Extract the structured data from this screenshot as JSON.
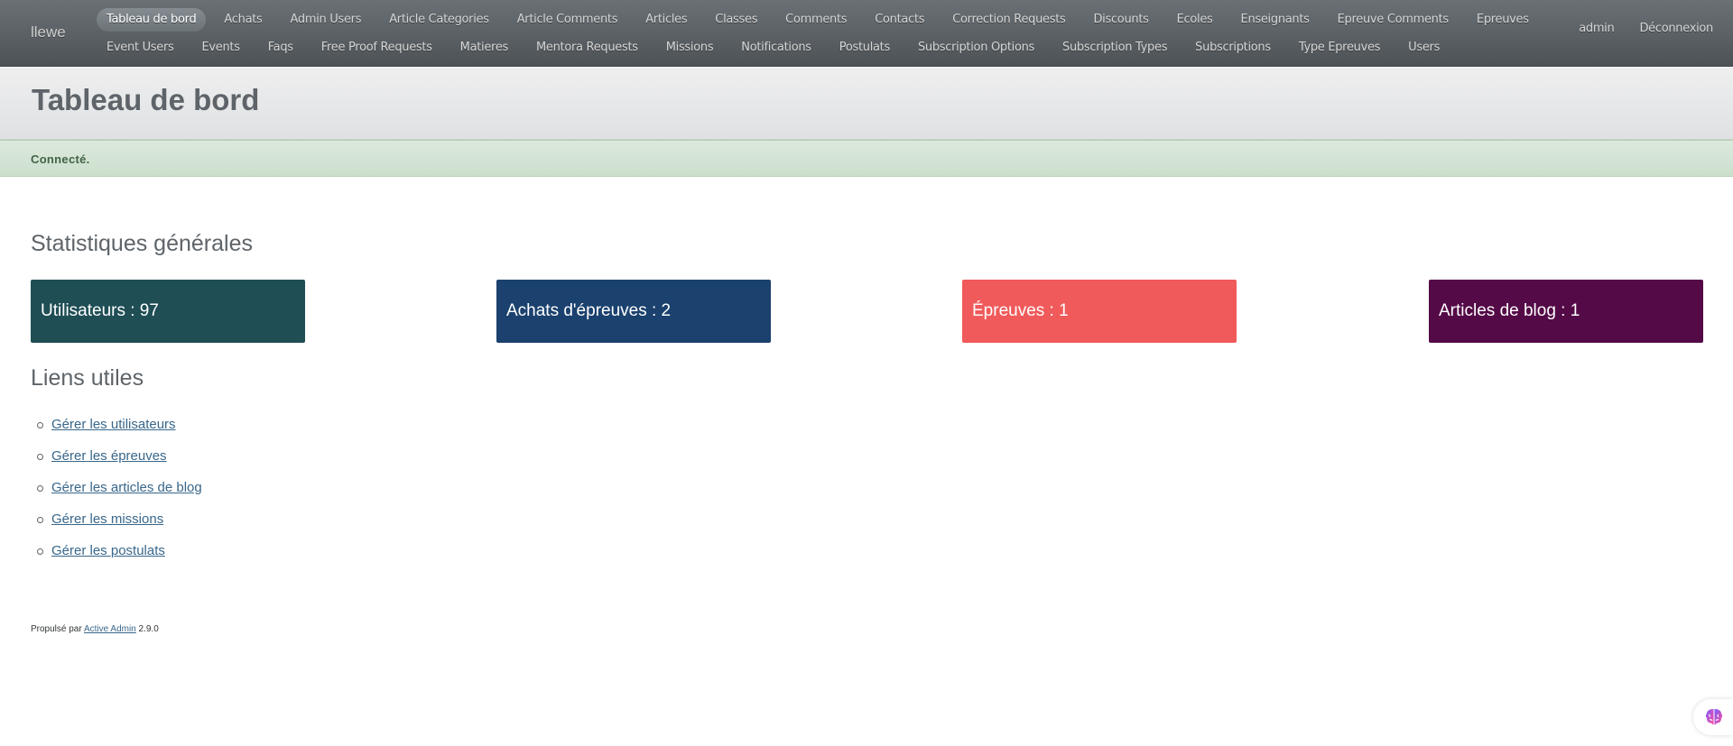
{
  "header": {
    "site_title": "llewe",
    "nav_row_1": [
      "Tableau de bord",
      "Achats",
      "Admin Users",
      "Article Categories",
      "Article Comments",
      "Articles",
      "Classes",
      "Comments",
      "Contacts",
      "Correction Requests",
      "Discounts",
      "Ecoles",
      "Enseignants",
      "Epreuve Comments",
      "Epreuves"
    ],
    "nav_row_2": [
      "Event Users",
      "Events",
      "Faqs",
      "Free Proof Requests",
      "Matieres",
      "Mentora Requests",
      "Missions",
      "Notifications",
      "Postulats",
      "Subscription Options",
      "Subscription Types",
      "Subscriptions",
      "Type Epreuves",
      "Users"
    ],
    "current_item": "Tableau de bord",
    "utility": {
      "user": "admin",
      "logout": "Déconnexion"
    }
  },
  "title_bar": {
    "title": "Tableau de bord"
  },
  "flash": {
    "notice": "Connecté."
  },
  "stats": {
    "title": "Statistiques générales",
    "cards": [
      {
        "label": "Utilisateurs : 97",
        "color": "#1f4e55"
      },
      {
        "label": "Achats d'épreuves : 2",
        "color": "#1b416e"
      },
      {
        "label": "Épreuves : 1",
        "color": "#f05a5b"
      },
      {
        "label": "Articles de blog : 1",
        "color": "#540a47"
      }
    ]
  },
  "links": {
    "title": "Liens utiles",
    "items": [
      "Gérer les utilisateurs",
      "Gérer les épreuves",
      "Gérer les articles de blog",
      "Gérer les missions",
      "Gérer les postulats"
    ]
  },
  "footer": {
    "prefix": "Propulsé par",
    "link": "Active Admin",
    "version": "2.9.0"
  },
  "widget": {
    "icon": "brain-icon"
  }
}
